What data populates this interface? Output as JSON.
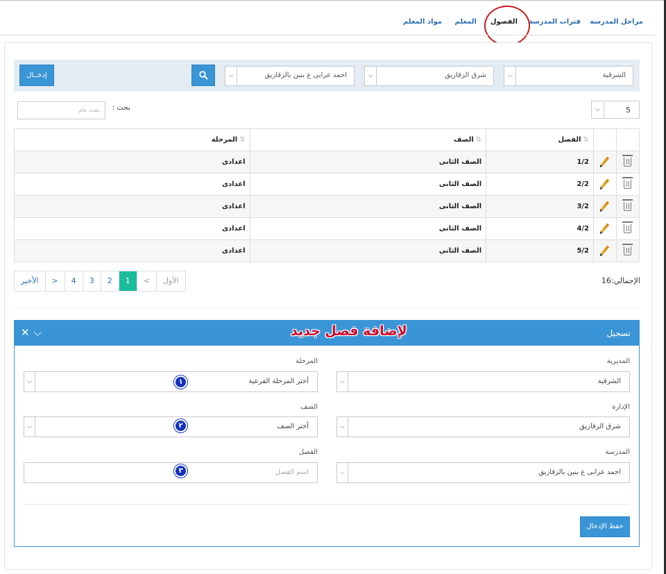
{
  "tabs": [
    {
      "label": "مراحل المدرسة",
      "active": false
    },
    {
      "label": "فترات المدرسة",
      "active": false
    },
    {
      "label": "الفصول",
      "active": true
    },
    {
      "label": "المعلم",
      "active": false
    },
    {
      "label": "مواد المعلم",
      "active": false
    }
  ],
  "filters": {
    "directorate": "الشرقية",
    "administration": "شرق الزقازيق",
    "school": "احمد عرابى ع بنين بالزقازيق",
    "submit_label": "إدخــال",
    "search_icon": "magnifier-icon"
  },
  "list": {
    "page_size": "5",
    "search_label": "بحث :",
    "search_placeholder": "بحث عام",
    "columns": {
      "stage": "المرحلة",
      "grade": "الصف",
      "class": "الفصل"
    },
    "rows": [
      {
        "stage": "اعدادى",
        "grade": "الصف الثانى",
        "class": "1/2"
      },
      {
        "stage": "اعدادى",
        "grade": "الصف الثانى",
        "class": "2/2"
      },
      {
        "stage": "اعدادى",
        "grade": "الصف الثانى",
        "class": "3/2"
      },
      {
        "stage": "اعدادى",
        "grade": "الصف الثانى",
        "class": "4/2"
      },
      {
        "stage": "اعدادى",
        "grade": "الصف الثانى",
        "class": "5/2"
      }
    ],
    "total_text": "الإجمالي:16",
    "pager": {
      "first": "الأول",
      "prev": "<",
      "pages": [
        "1",
        "2",
        "3",
        "4"
      ],
      "current": "1",
      "next": ">",
      "last": "الأخير"
    }
  },
  "panel": {
    "title": "تسجيل",
    "caption": "لإضافة فصل جديد",
    "fields": {
      "directorate_label": "المديرية",
      "directorate_value": "الشرقية",
      "administration_label": "الإدارة",
      "administration_value": "شرق الزقازيق",
      "school_label": "المدرسة",
      "school_value": "احمد عرابى ع بنين بالزقازيق",
      "stage_label": "المرحلة",
      "stage_placeholder": "أختر المرحلة الفرعية",
      "grade_label": "الصف",
      "grade_placeholder": "أختر الصف",
      "class_label": "الفصل",
      "class_placeholder": "اسم الفصل"
    },
    "badges": [
      "١",
      "٢",
      "٣"
    ],
    "save_label": "حفظ الإدخال"
  },
  "colors": {
    "primary": "#3a95d6",
    "pager_active": "#1abc9c",
    "highlight_ring": "#cc1a1a",
    "badge": "#1533b8",
    "caption": "#c8102e"
  }
}
